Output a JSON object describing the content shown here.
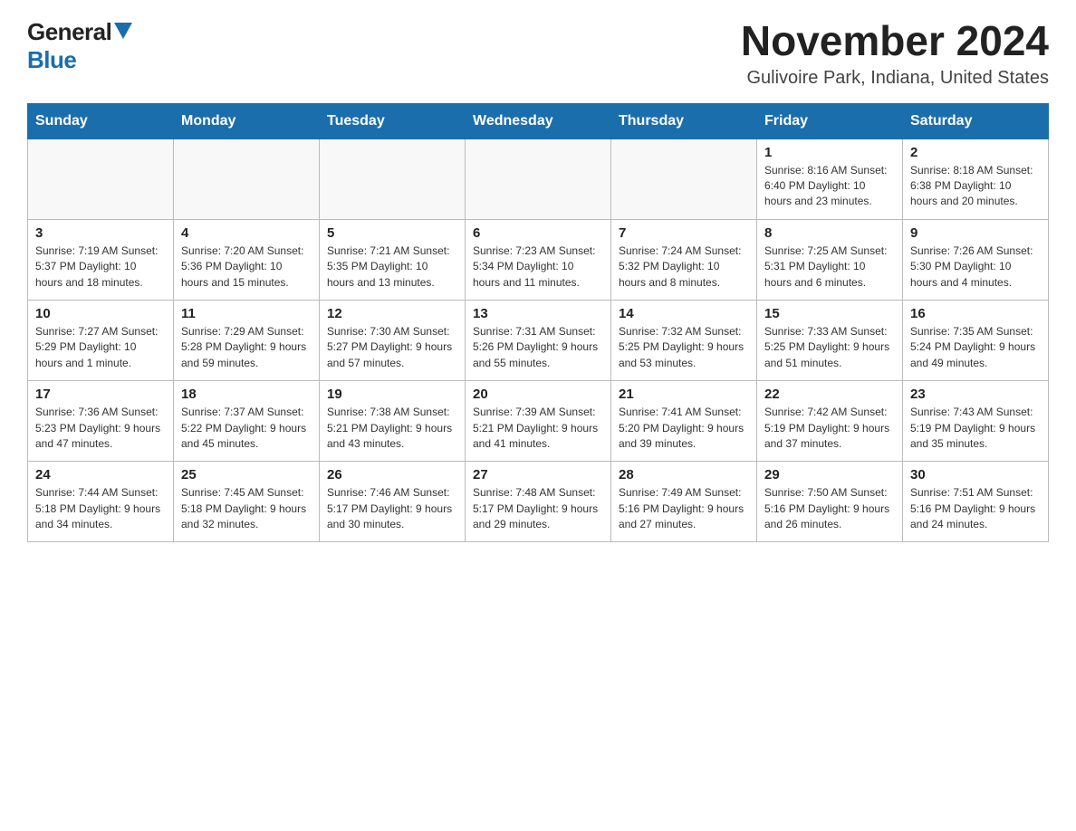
{
  "header": {
    "logo_general": "General",
    "logo_blue": "Blue",
    "title": "November 2024",
    "subtitle": "Gulivoire Park, Indiana, United States"
  },
  "calendar": {
    "days_of_week": [
      "Sunday",
      "Monday",
      "Tuesday",
      "Wednesday",
      "Thursday",
      "Friday",
      "Saturday"
    ],
    "weeks": [
      [
        {
          "day": null,
          "info": null
        },
        {
          "day": null,
          "info": null
        },
        {
          "day": null,
          "info": null
        },
        {
          "day": null,
          "info": null
        },
        {
          "day": null,
          "info": null
        },
        {
          "day": "1",
          "info": "Sunrise: 8:16 AM\nSunset: 6:40 PM\nDaylight: 10 hours and 23 minutes."
        },
        {
          "day": "2",
          "info": "Sunrise: 8:18 AM\nSunset: 6:38 PM\nDaylight: 10 hours and 20 minutes."
        }
      ],
      [
        {
          "day": "3",
          "info": "Sunrise: 7:19 AM\nSunset: 5:37 PM\nDaylight: 10 hours and 18 minutes."
        },
        {
          "day": "4",
          "info": "Sunrise: 7:20 AM\nSunset: 5:36 PM\nDaylight: 10 hours and 15 minutes."
        },
        {
          "day": "5",
          "info": "Sunrise: 7:21 AM\nSunset: 5:35 PM\nDaylight: 10 hours and 13 minutes."
        },
        {
          "day": "6",
          "info": "Sunrise: 7:23 AM\nSunset: 5:34 PM\nDaylight: 10 hours and 11 minutes."
        },
        {
          "day": "7",
          "info": "Sunrise: 7:24 AM\nSunset: 5:32 PM\nDaylight: 10 hours and 8 minutes."
        },
        {
          "day": "8",
          "info": "Sunrise: 7:25 AM\nSunset: 5:31 PM\nDaylight: 10 hours and 6 minutes."
        },
        {
          "day": "9",
          "info": "Sunrise: 7:26 AM\nSunset: 5:30 PM\nDaylight: 10 hours and 4 minutes."
        }
      ],
      [
        {
          "day": "10",
          "info": "Sunrise: 7:27 AM\nSunset: 5:29 PM\nDaylight: 10 hours and 1 minute."
        },
        {
          "day": "11",
          "info": "Sunrise: 7:29 AM\nSunset: 5:28 PM\nDaylight: 9 hours and 59 minutes."
        },
        {
          "day": "12",
          "info": "Sunrise: 7:30 AM\nSunset: 5:27 PM\nDaylight: 9 hours and 57 minutes."
        },
        {
          "day": "13",
          "info": "Sunrise: 7:31 AM\nSunset: 5:26 PM\nDaylight: 9 hours and 55 minutes."
        },
        {
          "day": "14",
          "info": "Sunrise: 7:32 AM\nSunset: 5:25 PM\nDaylight: 9 hours and 53 minutes."
        },
        {
          "day": "15",
          "info": "Sunrise: 7:33 AM\nSunset: 5:25 PM\nDaylight: 9 hours and 51 minutes."
        },
        {
          "day": "16",
          "info": "Sunrise: 7:35 AM\nSunset: 5:24 PM\nDaylight: 9 hours and 49 minutes."
        }
      ],
      [
        {
          "day": "17",
          "info": "Sunrise: 7:36 AM\nSunset: 5:23 PM\nDaylight: 9 hours and 47 minutes."
        },
        {
          "day": "18",
          "info": "Sunrise: 7:37 AM\nSunset: 5:22 PM\nDaylight: 9 hours and 45 minutes."
        },
        {
          "day": "19",
          "info": "Sunrise: 7:38 AM\nSunset: 5:21 PM\nDaylight: 9 hours and 43 minutes."
        },
        {
          "day": "20",
          "info": "Sunrise: 7:39 AM\nSunset: 5:21 PM\nDaylight: 9 hours and 41 minutes."
        },
        {
          "day": "21",
          "info": "Sunrise: 7:41 AM\nSunset: 5:20 PM\nDaylight: 9 hours and 39 minutes."
        },
        {
          "day": "22",
          "info": "Sunrise: 7:42 AM\nSunset: 5:19 PM\nDaylight: 9 hours and 37 minutes."
        },
        {
          "day": "23",
          "info": "Sunrise: 7:43 AM\nSunset: 5:19 PM\nDaylight: 9 hours and 35 minutes."
        }
      ],
      [
        {
          "day": "24",
          "info": "Sunrise: 7:44 AM\nSunset: 5:18 PM\nDaylight: 9 hours and 34 minutes."
        },
        {
          "day": "25",
          "info": "Sunrise: 7:45 AM\nSunset: 5:18 PM\nDaylight: 9 hours and 32 minutes."
        },
        {
          "day": "26",
          "info": "Sunrise: 7:46 AM\nSunset: 5:17 PM\nDaylight: 9 hours and 30 minutes."
        },
        {
          "day": "27",
          "info": "Sunrise: 7:48 AM\nSunset: 5:17 PM\nDaylight: 9 hours and 29 minutes."
        },
        {
          "day": "28",
          "info": "Sunrise: 7:49 AM\nSunset: 5:16 PM\nDaylight: 9 hours and 27 minutes."
        },
        {
          "day": "29",
          "info": "Sunrise: 7:50 AM\nSunset: 5:16 PM\nDaylight: 9 hours and 26 minutes."
        },
        {
          "day": "30",
          "info": "Sunrise: 7:51 AM\nSunset: 5:16 PM\nDaylight: 9 hours and 24 minutes."
        }
      ]
    ]
  }
}
